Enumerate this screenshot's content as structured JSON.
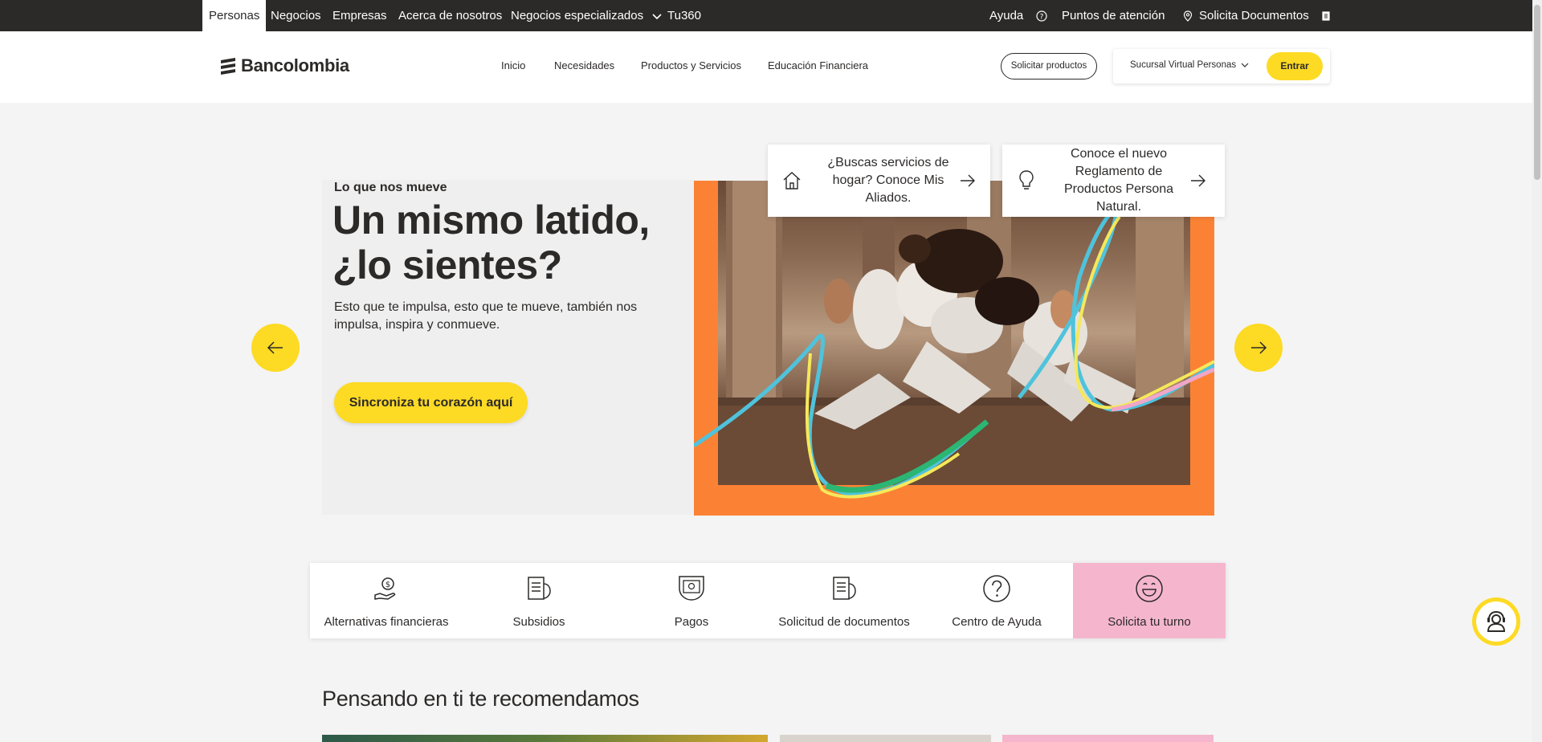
{
  "topbar": {
    "tabs": [
      "Personas",
      "Negocios",
      "Empresas",
      "Acerca de nosotros",
      "Negocios especializados",
      "Tu360"
    ],
    "right": [
      "Ayuda",
      "Puntos de atención",
      "Solicita Documentos"
    ]
  },
  "header": {
    "brand": "Bancolombia",
    "nav": [
      "Inicio",
      "Necesidades",
      "Productos y Servicios",
      "Educación Financiera"
    ],
    "solicitar_label": "Solicitar productos",
    "sucursal_label": "Sucursal Virtual Personas",
    "entrar_label": "Entrar"
  },
  "hero": {
    "eyebrow": "Lo que nos mueve",
    "title": "Un mismo latido, ¿lo sientes?",
    "description": "Esto que te impulsa, esto que te mueve, también nos impulsa, inspira y conmueve.",
    "cta": "Sincroniza tu corazón aquí"
  },
  "promos": [
    {
      "text": "¿Buscas servicios de hogar? Conoce Mis Aliados.",
      "icon": "house-icon"
    },
    {
      "text": "Conoce el nuevo Reglamento de Productos Persona Natural.",
      "icon": "lightbulb-icon"
    }
  ],
  "shortcuts": [
    {
      "label": "Alternativas financieras",
      "icon": "hand-money-icon"
    },
    {
      "label": "Subsidios",
      "icon": "document-icon"
    },
    {
      "label": "Pagos",
      "icon": "payment-icon"
    },
    {
      "label": "Solicitud de documentos",
      "icon": "document-icon"
    },
    {
      "label": "Centro de Ayuda",
      "icon": "question-icon"
    },
    {
      "label": "Solicita tu turno",
      "icon": "smiley-icon"
    }
  ],
  "recommend_title": "Pensando en ti te recomendamos",
  "colors": {
    "brand_yellow": "#fdda24",
    "dark": "#2c2a29",
    "orange": "#fb8234",
    "pink": "#f5b6cd"
  }
}
